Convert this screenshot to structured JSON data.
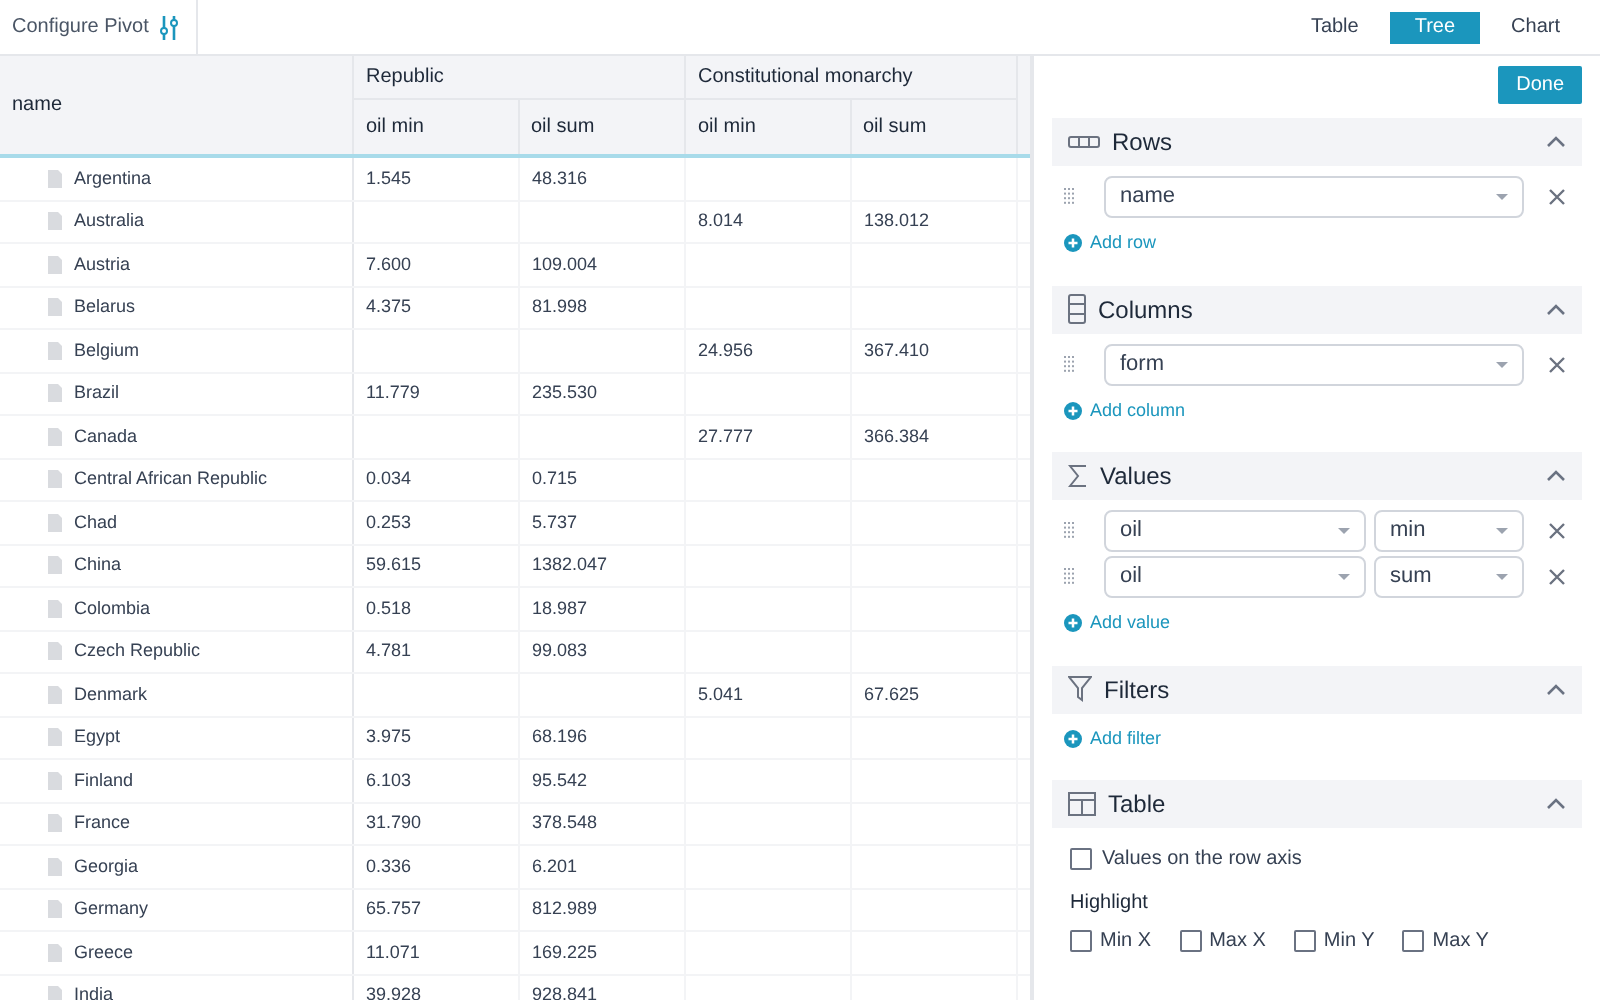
{
  "toolbar": {
    "configure_label": "Configure Pivot",
    "views": [
      {
        "label": "Table",
        "selected": false
      },
      {
        "label": "Tree",
        "selected": true
      },
      {
        "label": "Chart",
        "selected": false
      }
    ]
  },
  "table": {
    "row_header": "name",
    "column_groups": [
      {
        "label": "Republic",
        "columns": [
          "oil min",
          "oil sum"
        ]
      },
      {
        "label": "Constitutional monarchy",
        "columns": [
          "oil min",
          "oil sum"
        ]
      }
    ],
    "rows": [
      {
        "name": "Argentina",
        "cells": [
          "1.545",
          "48.316",
          "",
          ""
        ]
      },
      {
        "name": "Australia",
        "cells": [
          "",
          "",
          "8.014",
          "138.012"
        ]
      },
      {
        "name": "Austria",
        "cells": [
          "7.600",
          "109.004",
          "",
          ""
        ]
      },
      {
        "name": "Belarus",
        "cells": [
          "4.375",
          "81.998",
          "",
          ""
        ]
      },
      {
        "name": "Belgium",
        "cells": [
          "",
          "",
          "24.956",
          "367.410"
        ]
      },
      {
        "name": "Brazil",
        "cells": [
          "11.779",
          "235.530",
          "",
          ""
        ]
      },
      {
        "name": "Canada",
        "cells": [
          "",
          "",
          "27.777",
          "366.384"
        ]
      },
      {
        "name": "Central African Republic",
        "cells": [
          "0.034",
          "0.715",
          "",
          ""
        ]
      },
      {
        "name": "Chad",
        "cells": [
          "0.253",
          "5.737",
          "",
          ""
        ]
      },
      {
        "name": "China",
        "cells": [
          "59.615",
          "1382.047",
          "",
          ""
        ]
      },
      {
        "name": "Colombia",
        "cells": [
          "0.518",
          "18.987",
          "",
          ""
        ]
      },
      {
        "name": "Czech Republic",
        "cells": [
          "4.781",
          "99.083",
          "",
          ""
        ]
      },
      {
        "name": "Denmark",
        "cells": [
          "",
          "",
          "5.041",
          "67.625"
        ]
      },
      {
        "name": "Egypt",
        "cells": [
          "3.975",
          "68.196",
          "",
          ""
        ]
      },
      {
        "name": "Finland",
        "cells": [
          "6.103",
          "95.542",
          "",
          ""
        ]
      },
      {
        "name": "France",
        "cells": [
          "31.790",
          "378.548",
          "",
          ""
        ]
      },
      {
        "name": "Georgia",
        "cells": [
          "0.336",
          "6.201",
          "",
          ""
        ]
      },
      {
        "name": "Germany",
        "cells": [
          "65.757",
          "812.989",
          "",
          ""
        ]
      },
      {
        "name": "Greece",
        "cells": [
          "11.071",
          "169.225",
          "",
          ""
        ]
      },
      {
        "name": "India",
        "cells": [
          "39.928",
          "928.841",
          "",
          ""
        ]
      }
    ]
  },
  "panel": {
    "done_label": "Done",
    "sections": [
      {
        "kind": "rows",
        "title": "Rows",
        "fields": [
          [
            "name"
          ]
        ],
        "add_label": "Add row"
      },
      {
        "kind": "columns",
        "title": "Columns",
        "fields": [
          [
            "form"
          ]
        ],
        "add_label": "Add column"
      },
      {
        "kind": "values",
        "title": "Values",
        "fields": [
          [
            "oil",
            "min"
          ],
          [
            "oil",
            "sum"
          ]
        ],
        "add_label": "Add value"
      },
      {
        "kind": "filters",
        "title": "Filters",
        "add_label": "Add filter"
      },
      {
        "kind": "table",
        "title": "Table",
        "options": [
          {
            "label": "Values on the row axis",
            "checked": false
          }
        ],
        "highlight_label": "Highlight",
        "highlight_options": [
          {
            "label": "Min X",
            "checked": false
          },
          {
            "label": "Max X",
            "checked": false
          },
          {
            "label": "Min Y",
            "checked": false
          },
          {
            "label": "Max Y",
            "checked": false
          }
        ]
      }
    ]
  }
}
